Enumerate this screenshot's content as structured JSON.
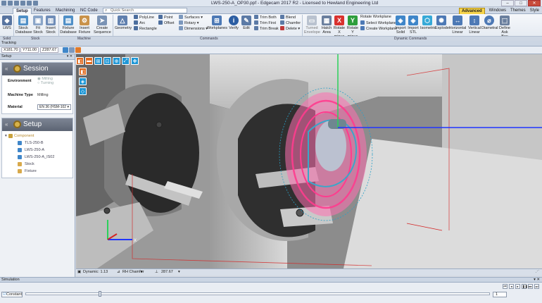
{
  "window": {
    "title": "LWS-250-A_OP30.ppf - Edgecam 2017 R2 - Licensed to Hewland Engineering Ltd"
  },
  "ribbon_tabs": [
    "Setup",
    "Features",
    "Machining",
    "NC Code"
  ],
  "quick_search": {
    "placeholder": "Quick Search"
  },
  "right_tabs": {
    "advanced": "Advanced",
    "windows": "Windows",
    "themes": "Themes",
    "style": "Style"
  },
  "ribbon": {
    "lws": "LWS",
    "stock_database": "Stock Database",
    "fit_stock": "Fit Stock",
    "insert_stock": "Insert Stock",
    "fixture_database": "Fixture Database",
    "insert_fixture": "Insert Fixture",
    "create_sequence": "Create Sequence",
    "geometry": "Geometry",
    "polyline": "PolyLine",
    "arc": "Arc",
    "rectangle": "Rectangle",
    "point": "Point",
    "offset": "Offset",
    "surfaces": "Surfaces",
    "rotary": "Rotary",
    "dimensions": "Dimensions",
    "workplanes": "Workplanes",
    "verify": "Verify",
    "edit": "Edit",
    "trim_both": "Trim Both",
    "trim_first": "Trim First",
    "trim_break": "Trim Break",
    "blend": "Blend",
    "chamfer": "Chamfer",
    "delete": "Delete",
    "turned_envelope": "Turned Envelope",
    "hatch_area": "Hatch Area",
    "rotate_x_minus": "Rotate X minus",
    "rotate_y_minus": "Rotate Y minus",
    "rotate_workplane": "Rotate Workplane",
    "select_workplane": "Select Workplane",
    "create_workplane": "Create Workplane",
    "import_solid": "Import Solid",
    "import_stl": "Import STL",
    "isometric": "Isometric",
    "explode": "Explode",
    "horizontal_linear": "Horizontal Linear",
    "vertical_linear": "Vertical Linear",
    "diametral": "Diametral",
    "define_ask_box": "Define Ask Box"
  },
  "ribbon_groups": {
    "solid": "Solid",
    "stock": "Stock",
    "machine": "Machine",
    "commands": "Commands",
    "dynamic_commands": "Dynamic Commands"
  },
  "tracking": {
    "header": "Tracking",
    "x": "X181.70",
    "y": "Y711.00",
    "z": "Z287.67"
  },
  "setup_panel": {
    "header": "Setup",
    "session_title": "Session",
    "environment_label": "Environment",
    "env_milling": "Milling",
    "env_turning": "Turning",
    "machine_type_label": "Machine Type",
    "machine_type_value": "Milling",
    "material_label": "Material",
    "material_value": "EN 36 (HSM-102",
    "setup_title": "Setup",
    "tree": [
      {
        "label": "Component"
      },
      {
        "label": "TLS-250-B"
      },
      {
        "label": "LWS-250-A"
      },
      {
        "label": "LWS-250-A_IS02"
      },
      {
        "label": "Stock"
      },
      {
        "label": "Fixture"
      }
    ]
  },
  "status_bar": {
    "dynamic": "Dynamic: 1.13",
    "chamfer": "RH Chamfer",
    "z_value": "287.67"
  },
  "simulation": {
    "header": "Simulation",
    "mode": "Constant",
    "speed": "1"
  },
  "colors": {
    "accent": "#f3c623",
    "toolpath": "#ff3c8e",
    "axis_red": "#d42525",
    "axis_green": "#2bd15a",
    "axis_blue": "#1f35ff"
  }
}
